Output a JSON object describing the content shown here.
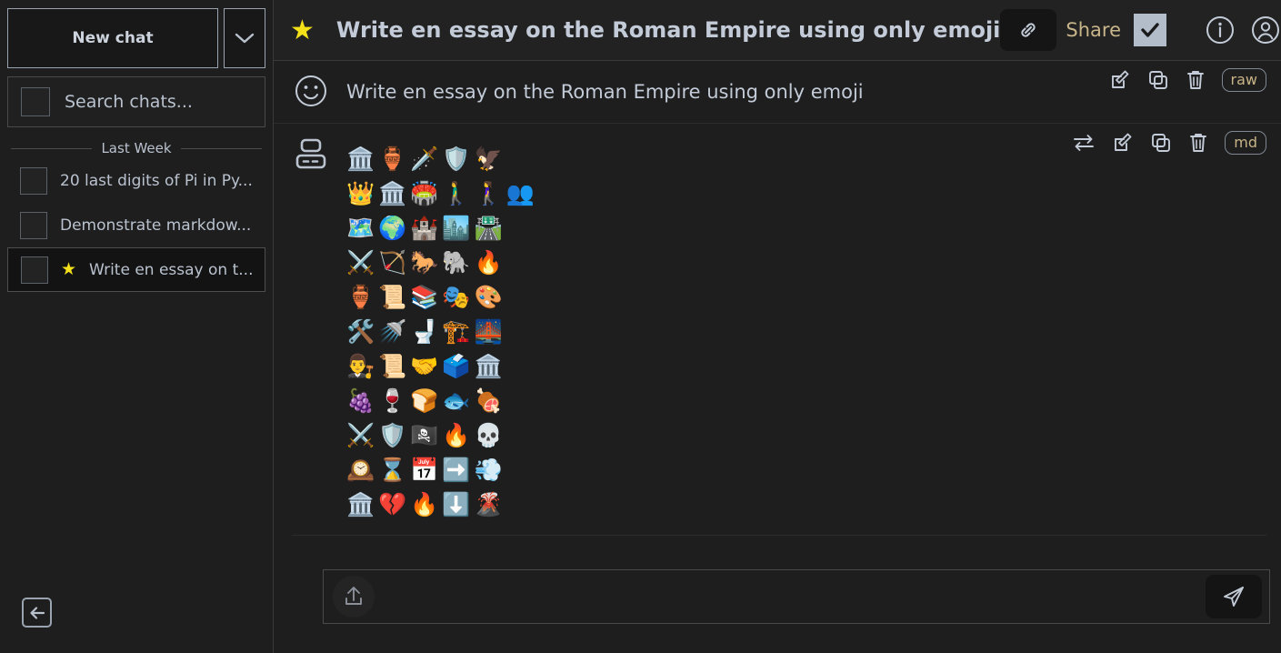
{
  "sidebar": {
    "new_chat_label": "New chat",
    "new_chat_dropdown_icon": "chevron-down-icon",
    "search_placeholder": "Search chats...",
    "search_value": "",
    "section_label": "Last Week",
    "chats": [
      {
        "label": "20 last digits of Pi in Py...",
        "starred": false,
        "selected": false
      },
      {
        "label": "Demonstrate markdow...",
        "starred": false,
        "selected": false
      },
      {
        "label": "Write en essay on t...",
        "starred": true,
        "selected": true,
        "star_glyph": "★"
      }
    ],
    "collapse_icon": "arrow-left-icon"
  },
  "header": {
    "star_glyph": "★",
    "title": "Write en essay on the Roman Empire using only emoji",
    "link_icon": "link-icon",
    "share_label": "Share",
    "share_checked": true,
    "share_check_glyph": "✔",
    "info_icon": "info-circle-icon",
    "account_icon": "user-account-icon"
  },
  "user_message": {
    "avatar_icon": "smiley-face-icon",
    "text": "Write en essay on the Roman Empire using only emoji",
    "actions": {
      "edit": "edit-icon",
      "copy": "copy-icon",
      "delete": "trash-icon",
      "format_pill": "raw"
    }
  },
  "assistant_message": {
    "avatar_icon": "computer-icon",
    "actions": {
      "regenerate": "regenerate-icon",
      "edit": "edit-icon",
      "copy": "copy-icon",
      "delete": "trash-icon",
      "format_pill": "md"
    },
    "emoji_lines": [
      "🏛️🏺🗡️🛡️🦅",
      "👑🏛️🏟️🚶‍♂️🚶‍♀️👥",
      "🗺️🌍🏰🏙️🛣️",
      "⚔️🏹🐎🐘🔥",
      "🏺📜📚🎭🎨",
      "🛠️🚿🚽🏗️🌉",
      "👨‍⚖️📜🤝🗳️🏛️",
      "🍇🍷🍞🐟🍖",
      "⚔️🛡️🏴‍☠️🔥💀",
      "🕰️⌛📅➡️💨",
      "🏛️💔🔥⬇️🌋"
    ]
  },
  "composer": {
    "upload_icon": "upload-icon",
    "input_value": "",
    "input_placeholder": "",
    "send_icon": "send-icon"
  },
  "colors": {
    "background": "#1e1e1e",
    "header_background": "#222222",
    "text": "#c2cbd7",
    "accent_star": "#f5e11a",
    "share_text": "#c8b58a",
    "border": "#4a4a4a"
  }
}
